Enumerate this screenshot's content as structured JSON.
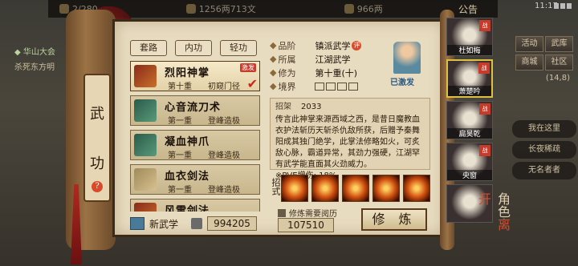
{
  "top_bar": {
    "partial_stat": "2/280",
    "money": "1256两713文",
    "gold": "966两",
    "announce": "公告",
    "clock": "11:17"
  },
  "left_panel": {
    "line1": "◆ 华山大会",
    "line2": "杀死东方明"
  },
  "right_menu": {
    "buttons": [
      "活动",
      "武库",
      "商城",
      "社区"
    ],
    "num": "(14,8)",
    "list": [
      "我在这里",
      "长夜稀疏",
      "无名者者"
    ]
  },
  "scroll": {
    "title_top": "武",
    "title_bottom": "功",
    "help": "?"
  },
  "tabs": [
    "套路",
    "内功",
    "轻功"
  ],
  "skills": [
    {
      "name": "烈阳神掌",
      "level": "第十重",
      "progress": "初窥门径",
      "badge": "激发",
      "active": true
    },
    {
      "name": "心音流刀术",
      "level": "第一重",
      "progress": "登峰造极",
      "active": false
    },
    {
      "name": "凝血神爪",
      "level": "第一重",
      "progress": "登峰造极",
      "active": false
    },
    {
      "name": "血衣剑法",
      "level": "第一重",
      "progress": "登峰造极",
      "active": false
    },
    {
      "name": "风雷剑法",
      "level": "",
      "progress": "",
      "active": false
    }
  ],
  "bottom_left": {
    "new_label": "新武学",
    "value": "994205"
  },
  "info": {
    "rank_key": "品阶",
    "rank_val": "镇派武学",
    "rank_pill": "评",
    "belong_key": "所属",
    "belong_val": "江湖武学",
    "cultivate_key": "修为",
    "cultivate_val": "第十重(十)",
    "realm_key": "境界",
    "master_label": "已激发"
  },
  "desc": {
    "head_key": "招架",
    "head_val": "2033",
    "text": "传言此神掌来源西域之西，是昔日魔教血衣护法斩历天斩杀仇敌所获，后赠予秦舞阳成其独门绝学，此掌法修略如火，可炙敌心脉，霸道异常，其劲力强硬，江湖罕有武学能直面其火劲威力。",
    "pve": "※PVE增伤: 18%"
  },
  "moves": {
    "label": "招式",
    "count": 5
  },
  "cultivate": {
    "need_label": "修炼需要阅历",
    "need_value": "107510",
    "button": "修 炼"
  },
  "characters": [
    {
      "name": "杜如梅",
      "tag": "战"
    },
    {
      "name": "萧楚吟",
      "tag": "战"
    },
    {
      "name": "扁昊乾",
      "tag": "战"
    },
    {
      "name": "央窗",
      "tag": "战"
    },
    {
      "name": "",
      "tag": ""
    }
  ],
  "role_button": {
    "main": "角色",
    "sub": "离开"
  }
}
